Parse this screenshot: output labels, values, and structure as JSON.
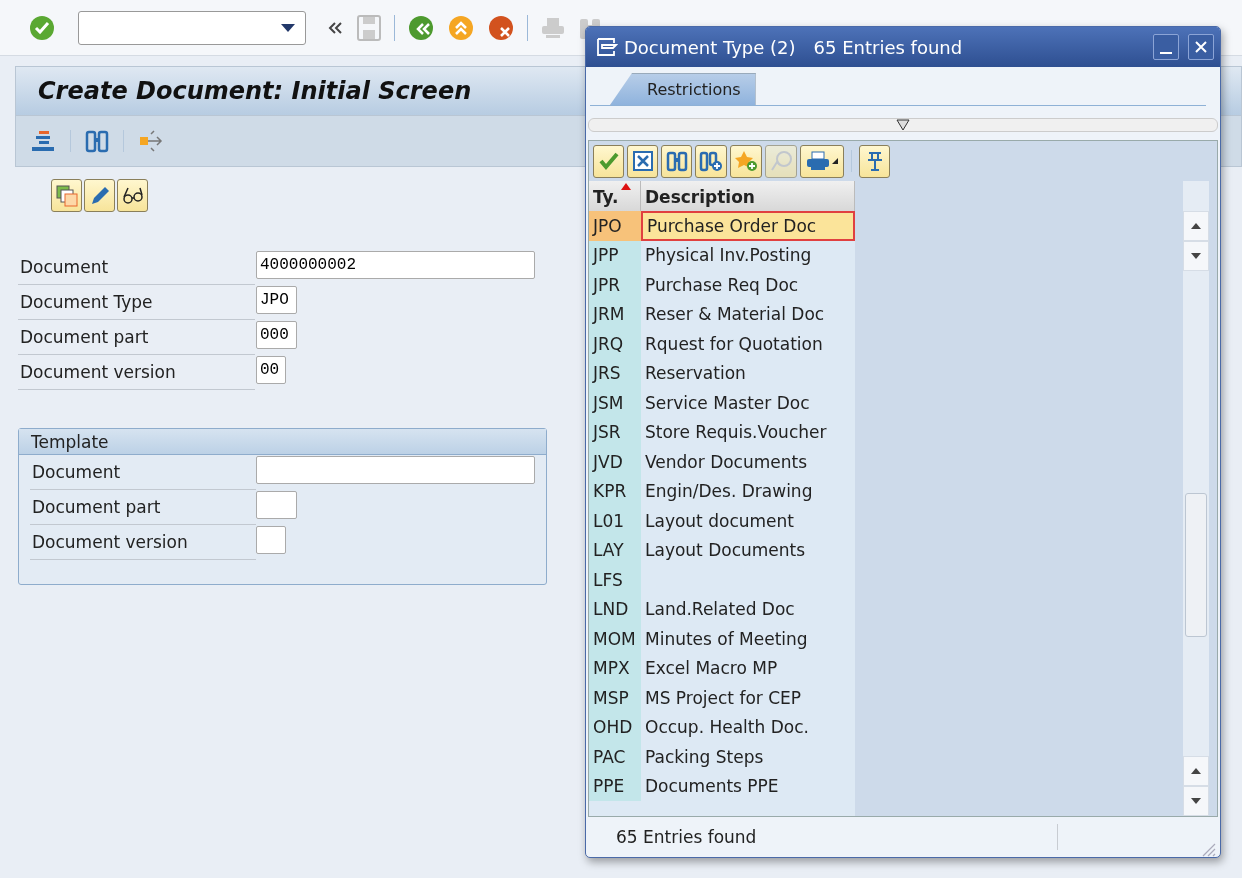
{
  "screen": {
    "title": "Create Document: Initial Screen"
  },
  "fields": [
    {
      "label": "Document",
      "value": "4000000002",
      "kind": "long"
    },
    {
      "label": "Document Type",
      "value": "JPO",
      "kind": "short"
    },
    {
      "label": "Document part",
      "value": "000",
      "kind": "short"
    },
    {
      "label": "Document version",
      "value": "00",
      "kind": "tiny"
    }
  ],
  "template": {
    "title": "Template",
    "fields": [
      {
        "label": "Document",
        "kind": "long"
      },
      {
        "label": "Document part",
        "kind": "short"
      },
      {
        "label": "Document version",
        "kind": "tiny"
      }
    ]
  },
  "popup": {
    "title": "Document Type (2)",
    "subtitle": "65 Entries found",
    "tabs": [
      {
        "label": "Restrictions",
        "selected": true
      }
    ],
    "columns": [
      {
        "label": "Ty.",
        "sorted": true
      },
      {
        "label": "Description",
        "sorted": false
      }
    ],
    "rows": [
      {
        "type": "JPO",
        "description": "Purchase Order Doc",
        "selected": true
      },
      {
        "type": "JPP",
        "description": "Physical Inv.Posting",
        "selected": false
      },
      {
        "type": "JPR",
        "description": "Purchase Req Doc",
        "selected": false
      },
      {
        "type": "JRM",
        "description": "Reser & Material Doc",
        "selected": false
      },
      {
        "type": "JRQ",
        "description": "Rquest for Quotation",
        "selected": false
      },
      {
        "type": "JRS",
        "description": "Reservation",
        "selected": false
      },
      {
        "type": "JSM",
        "description": "Service Master Doc",
        "selected": false
      },
      {
        "type": "JSR",
        "description": "Store Requis.Voucher",
        "selected": false
      },
      {
        "type": "JVD",
        "description": "Vendor Documents",
        "selected": false
      },
      {
        "type": "KPR",
        "description": "Engin/Des. Drawing",
        "selected": false
      },
      {
        "type": "L01",
        "description": "Layout document",
        "selected": false
      },
      {
        "type": "LAY",
        "description": "Layout Documents",
        "selected": false
      },
      {
        "type": "LFS",
        "selected": false
      },
      {
        "type": "LND",
        "description": "Land.Related Doc",
        "selected": false
      },
      {
        "type": "MOM",
        "description": "Minutes of Meeting",
        "selected": false
      },
      {
        "type": "MPX",
        "description": "Excel Macro MP",
        "selected": false
      },
      {
        "type": "MSP",
        "description": "MS Project for CEP",
        "selected": false
      },
      {
        "type": "OHD",
        "description": "Occup. Health Doc.",
        "selected": false
      },
      {
        "type": "PAC",
        "description": "Packing Steps",
        "selected": false
      },
      {
        "type": "PPE",
        "description": "Documents PPE",
        "selected": false
      }
    ],
    "status": "65 Entries found"
  }
}
